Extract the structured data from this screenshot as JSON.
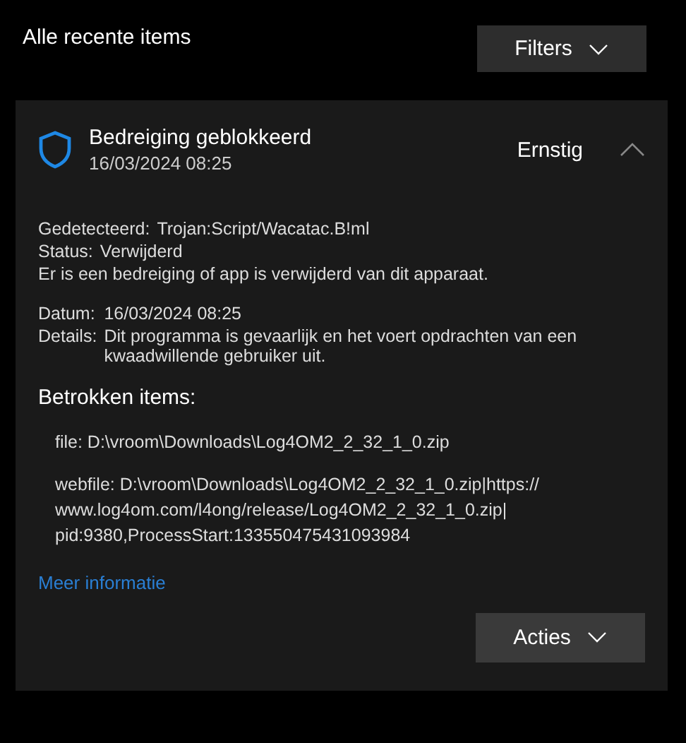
{
  "heading": "Alle recente items",
  "filters_button": "Filters",
  "threat": {
    "title": "Bedreiging geblokkeerd",
    "date": "16/03/2024 08:25",
    "severity": "Ernstig",
    "expanded": true,
    "info": [
      {
        "label": "Gedetecteerd:",
        "value": "Trojan:Script/Wacatac.B!ml"
      },
      {
        "label": "Status:",
        "value": "Verwijderd"
      }
    ],
    "message": "Er is een bedreiging of app is verwijderd van dit apparaat.",
    "details": [
      {
        "label": "Datum:",
        "value": "16/03/2024 08:25"
      },
      {
        "label": "Details:",
        "value": "Dit programma is gevaarlijk en het voert opdrachten van een kwaadwillende gebruiker uit."
      }
    ],
    "affected_heading": "Betrokken items:",
    "affected_items": [
      "file: D:\\vroom\\Downloads\\Log4OM2_2_32_1_0.zip",
      "webfile: D:\\vroom\\Downloads\\Log4OM2_2_32_1_0.zip|https:// www.log4om.com/l4ong/release/Log4OM2_2_32_1_0.zip| pid:9380,ProcessStart:133550475431093984"
    ],
    "more_info_link": "Meer informatie",
    "actions_button": "Acties"
  }
}
